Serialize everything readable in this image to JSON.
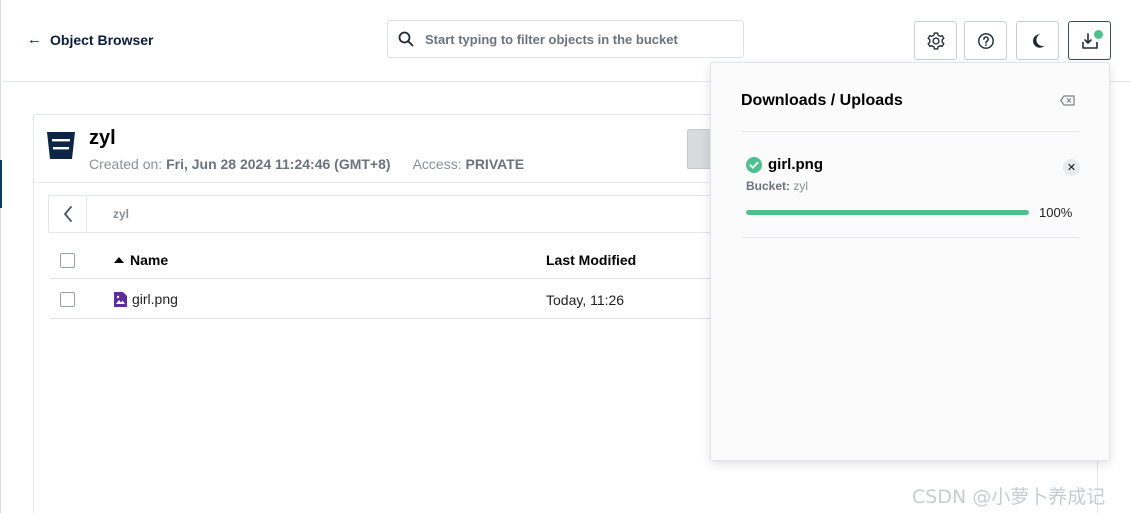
{
  "header": {
    "back_label": "Object Browser",
    "search_placeholder": "Start typing to filter objects in the bucket",
    "buttons": [
      "gear-icon",
      "help-icon",
      "moon-icon",
      "download-icon"
    ]
  },
  "bucket": {
    "name": "zyl",
    "created_label": "Created on:",
    "created_value": "Fri, Jun 28 2024 11:24:46 (GMT+8)",
    "access_label": "Access:",
    "access_value": "PRIVATE"
  },
  "breadcrumb": {
    "path": "zyl"
  },
  "table": {
    "columns": [
      "Name",
      "Last Modified"
    ],
    "rows": [
      {
        "name": "girl.png",
        "modified": "Today, 11:26"
      }
    ]
  },
  "transfers": {
    "title": "Downloads / Uploads",
    "items": [
      {
        "name": "girl.png",
        "bucket_label": "Bucket:",
        "bucket": "zyl",
        "progress_label": "100%",
        "progress": 1.0
      }
    ]
  },
  "colors": {
    "accent": "#4cc08d",
    "brand_dark": "#081c42"
  },
  "watermark": "CSDN @小萝卜养成记"
}
